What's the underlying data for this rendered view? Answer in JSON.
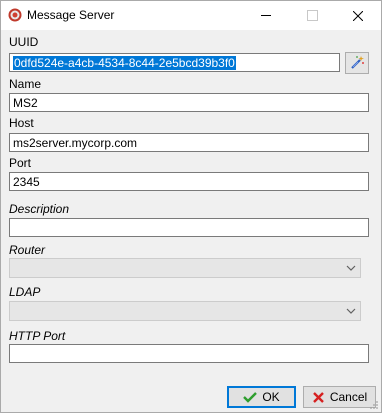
{
  "window": {
    "title": "Message Server",
    "icon": "app-record-icon"
  },
  "colors": {
    "selection": "#0078d7",
    "focus_border": "#0078d7",
    "disabled_combo": "#e6e6e6"
  },
  "form": {
    "uuid": {
      "label": "UUID",
      "value": "0dfd524e-a4cb-4534-8c44-2e5bcd39b3f0",
      "generate_icon": "magic-wand-icon"
    },
    "name": {
      "label": "Name",
      "value": "MS2"
    },
    "host": {
      "label": "Host",
      "value": "ms2server.mycorp.com"
    },
    "port": {
      "label": "Port",
      "value": "2345"
    },
    "description": {
      "label": "Description",
      "value": ""
    },
    "router": {
      "label": "Router",
      "value": ""
    },
    "ldap": {
      "label": "LDAP",
      "value": ""
    },
    "http_port": {
      "label": "HTTP Port",
      "value": ""
    }
  },
  "buttons": {
    "ok": {
      "label": "OK",
      "icon": "checkmark-icon"
    },
    "cancel": {
      "label": "Cancel",
      "icon": "red-x-icon"
    }
  }
}
